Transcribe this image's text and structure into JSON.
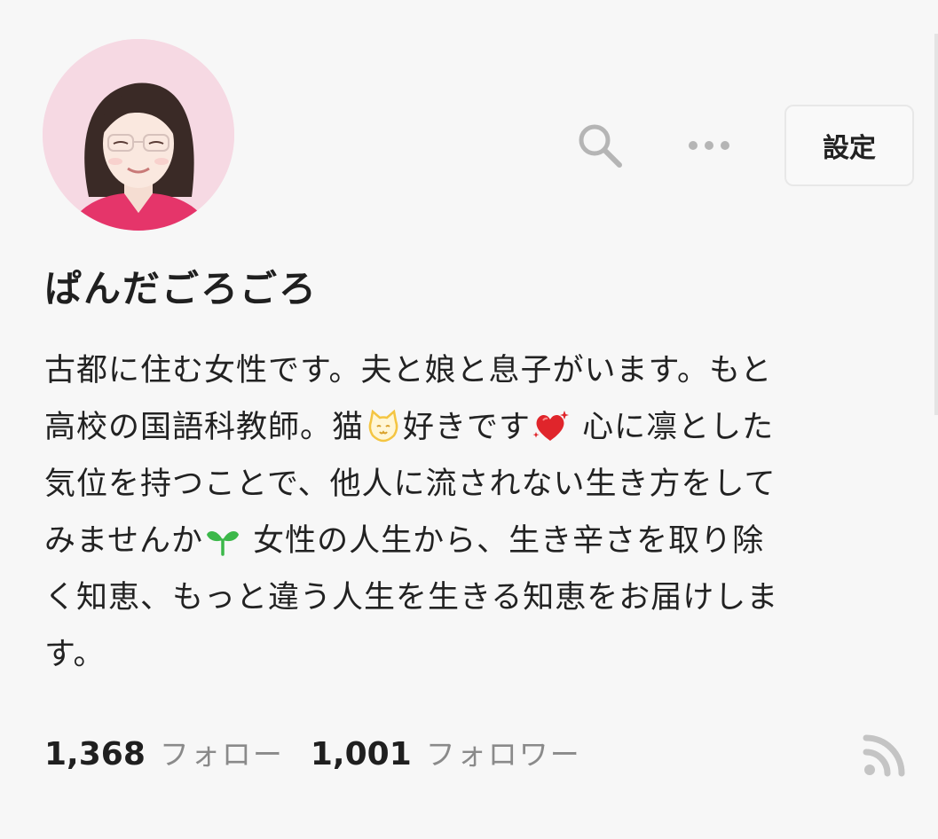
{
  "profile": {
    "avatar_alt": "profile avatar",
    "name": "ぱんだごろごろ"
  },
  "toolbar": {
    "search_icon": "search-icon",
    "more_icon": "more-icon",
    "settings_label": "設定"
  },
  "bio": {
    "lines": [
      [
        "古都に住む女性です。夫と娘と息子がいます。もと"
      ],
      [
        "高校の国語科教師。猫",
        "好きです",
        " 心に凛とした"
      ],
      [
        "気位を持つことで、他人に流されない生き方をして"
      ],
      [
        "みませんか",
        " 女性の人生から、生き辛さを取り除"
      ],
      [
        "く知恵、もっと違う人生を生きる知恵をお届けしま"
      ],
      [
        "す。"
      ]
    ],
    "emojis": [
      "cat-face-icon",
      "sparkling-heart-icon",
      "seedling-icon"
    ]
  },
  "stats": {
    "following_count": "1,368",
    "following_label": "フォロー",
    "followers_count": "1,001",
    "followers_label": "フォロワー"
  },
  "footer": {
    "rss_icon": "rss-icon"
  },
  "colors": {
    "background": "#f7f7f7",
    "text": "#222222",
    "muted": "#8a8a8a",
    "icon_gray": "#b5b5b5",
    "avatar_bg": "#f6d9e3",
    "heart_red": "#e0252b",
    "seedling_green": "#3cb84a",
    "cat_yellow": "#f4c542"
  }
}
